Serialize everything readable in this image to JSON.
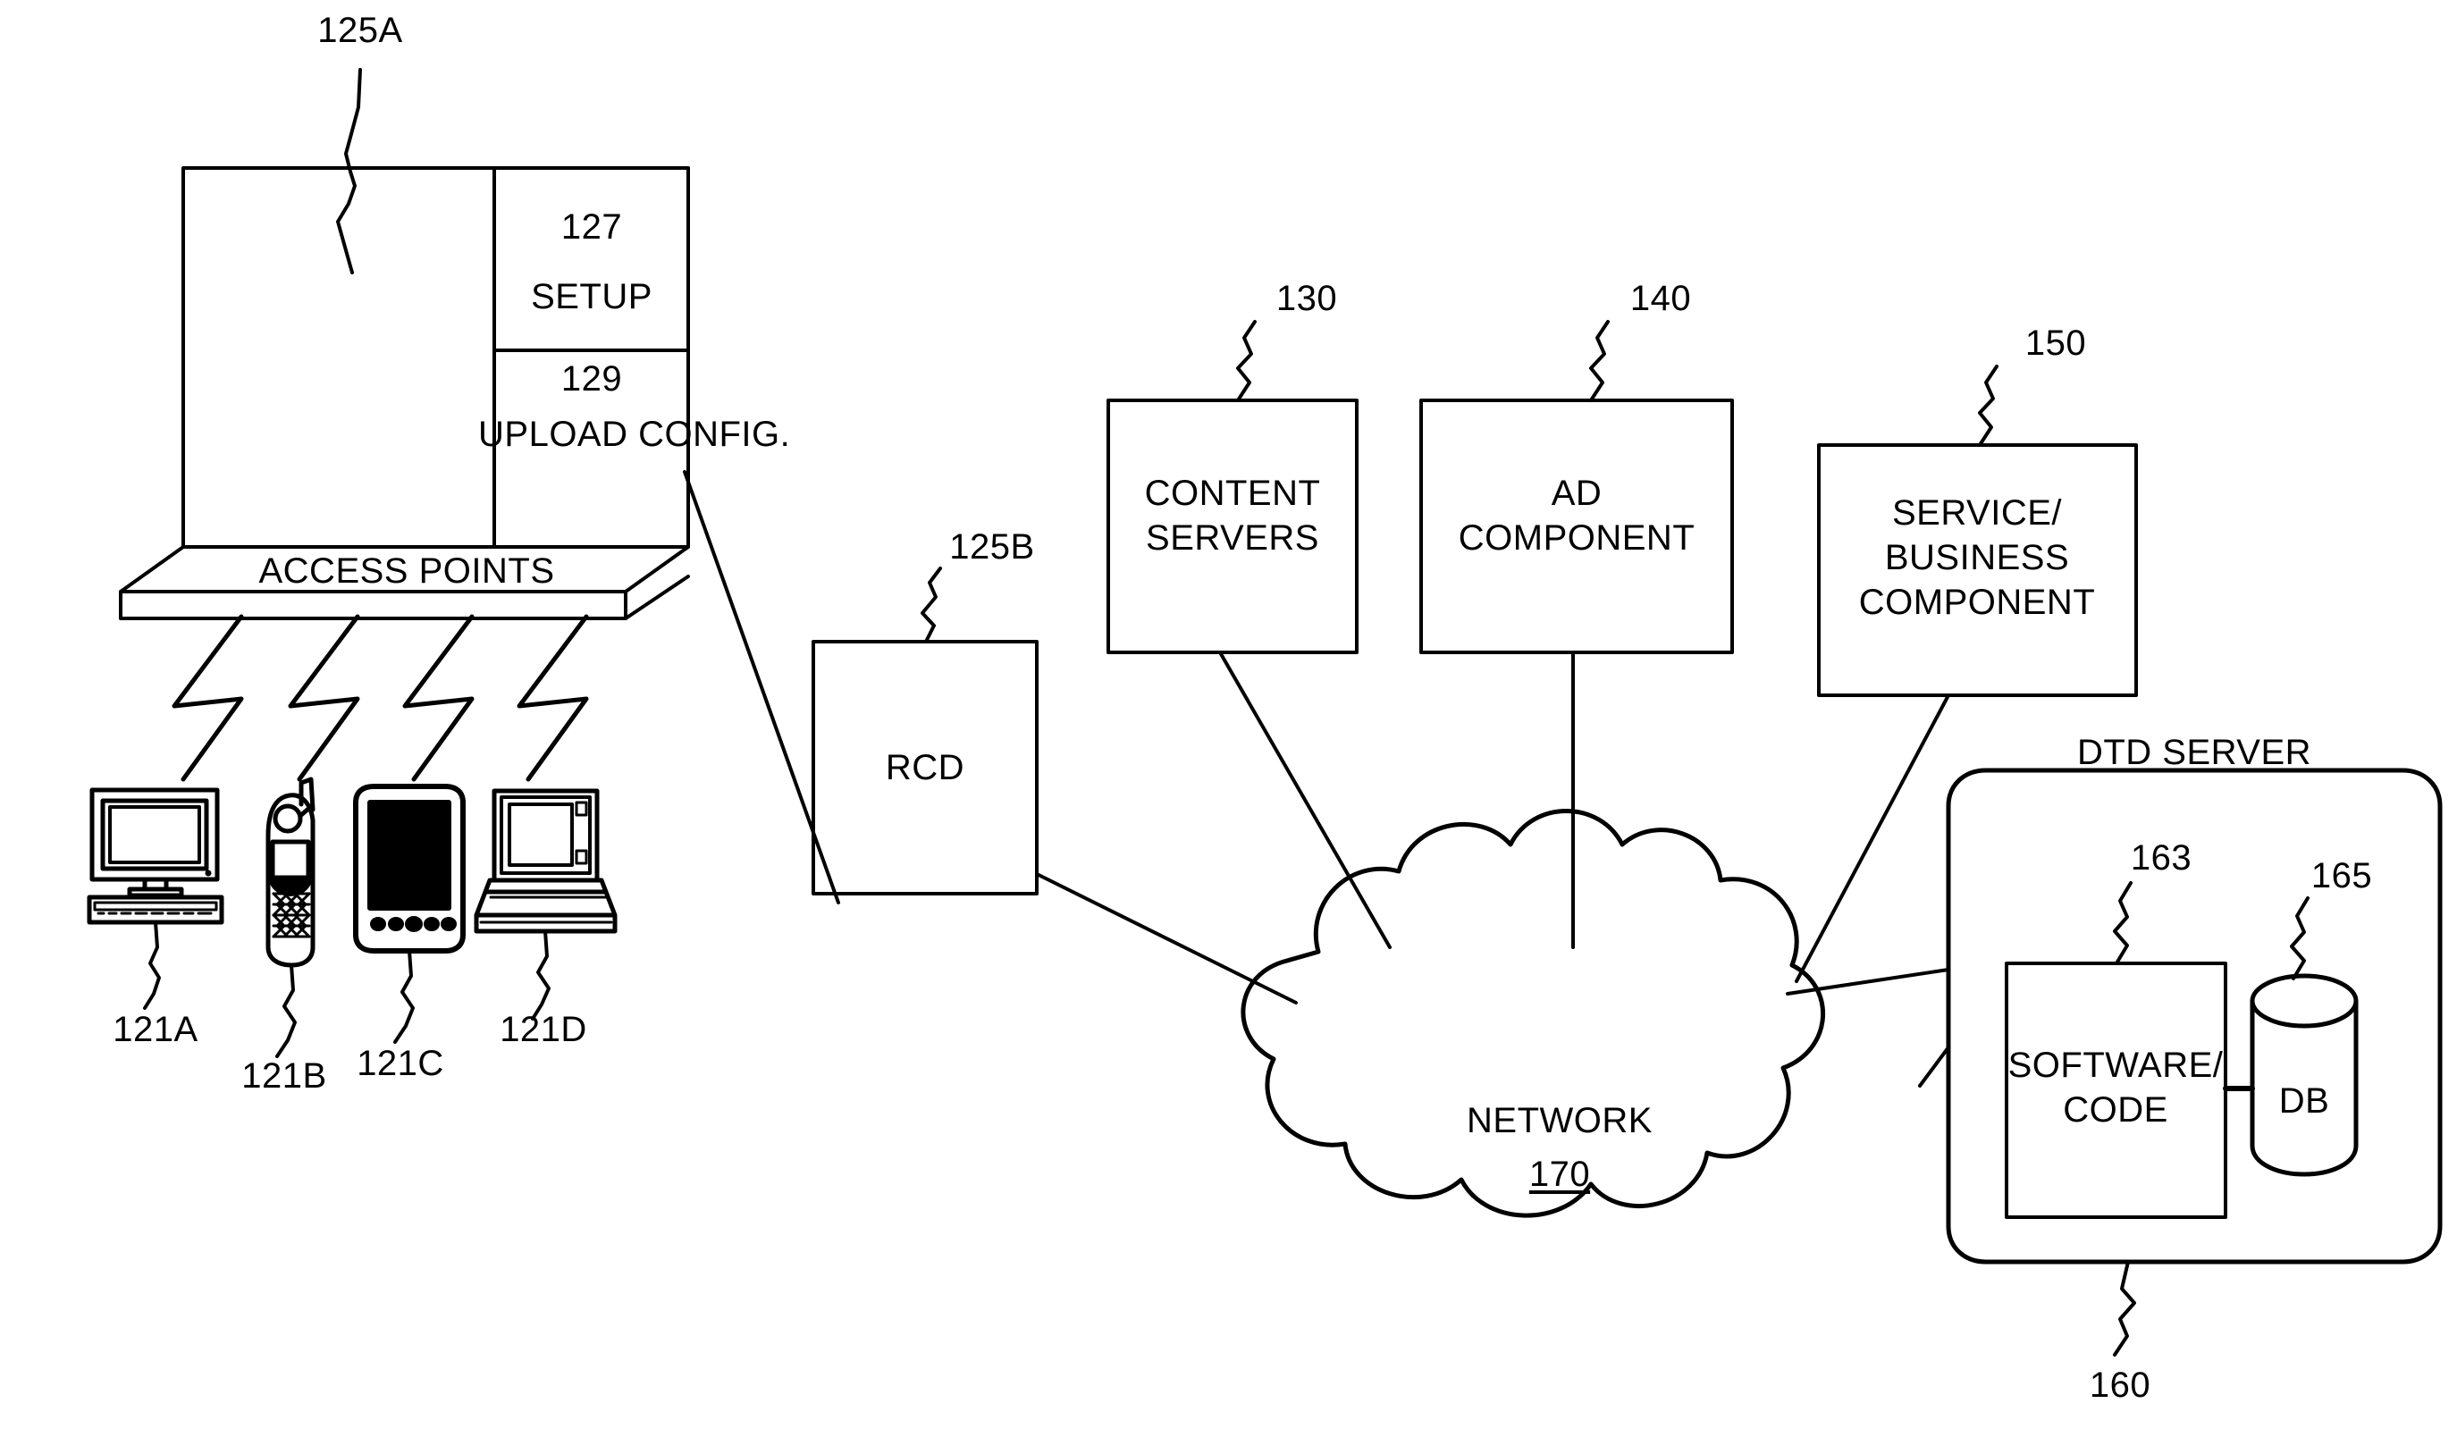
{
  "diagram": {
    "title": "Network system architecture diagram",
    "stroke_color": "#000000",
    "background_color": "#ffffff"
  },
  "admin_station": {
    "ref": "125A",
    "base_label": "ACCESS POINTS",
    "panels": [
      {
        "ref": "127",
        "label": "SETUP"
      },
      {
        "ref": "129",
        "label": "UPLOAD CONFIG."
      }
    ]
  },
  "client_devices": [
    {
      "ref": "121A",
      "icon": "desktop-computer-icon",
      "name": "desktop-computer"
    },
    {
      "ref": "121B",
      "icon": "mobile-phone-icon",
      "name": "mobile-phone"
    },
    {
      "ref": "121C",
      "icon": "pda-icon",
      "name": "pda"
    },
    {
      "ref": "121D",
      "icon": "laptop-icon",
      "name": "laptop"
    }
  ],
  "nodes": {
    "rcd": {
      "ref": "125B",
      "label": "RCD"
    },
    "content_servers": {
      "ref": "130",
      "label_line1": "CONTENT",
      "label_line2": "SERVERS"
    },
    "ad_component": {
      "ref": "140",
      "label_line1": "AD",
      "label_line2": "COMPONENT"
    },
    "service_business_component": {
      "ref": "150",
      "label_line1": "SERVICE/",
      "label_line2": "BUSINESS",
      "label_line3": "COMPONENT"
    },
    "network_cloud": {
      "ref": "170",
      "label": "NETWORK"
    },
    "dtd_server": {
      "ref": "160",
      "title": "DTD SERVER",
      "software": {
        "ref": "163",
        "label_line1": "SOFTWARE/",
        "label_line2": "CODE"
      },
      "database": {
        "ref": "165",
        "label": "DB"
      }
    }
  }
}
